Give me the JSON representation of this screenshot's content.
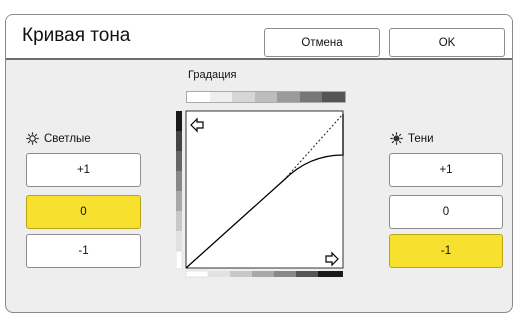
{
  "window": {
    "title": "Кривая тона"
  },
  "buttons": {
    "cancel": "Отмена",
    "ok": "OK"
  },
  "gradation": {
    "title": "Градация"
  },
  "highlights": {
    "label": "Светлые",
    "icon": "sun-outline-icon",
    "options": [
      "+1",
      "0",
      "-1"
    ],
    "selected": "0"
  },
  "shadows": {
    "label": "Тени",
    "icon": "sun-filled-icon",
    "options": [
      "+1",
      "0",
      "-1"
    ],
    "selected": "-1"
  },
  "colors": {
    "selected": "#f8e12e",
    "title_border": "#6d6d6d",
    "panel": "#eeeeee"
  },
  "gradient_steps": [
    "#ffffff",
    "#eeeeee",
    "#d6d6d6",
    "#bdbdbd",
    "#9a9a9a",
    "#777777",
    "#555555"
  ]
}
